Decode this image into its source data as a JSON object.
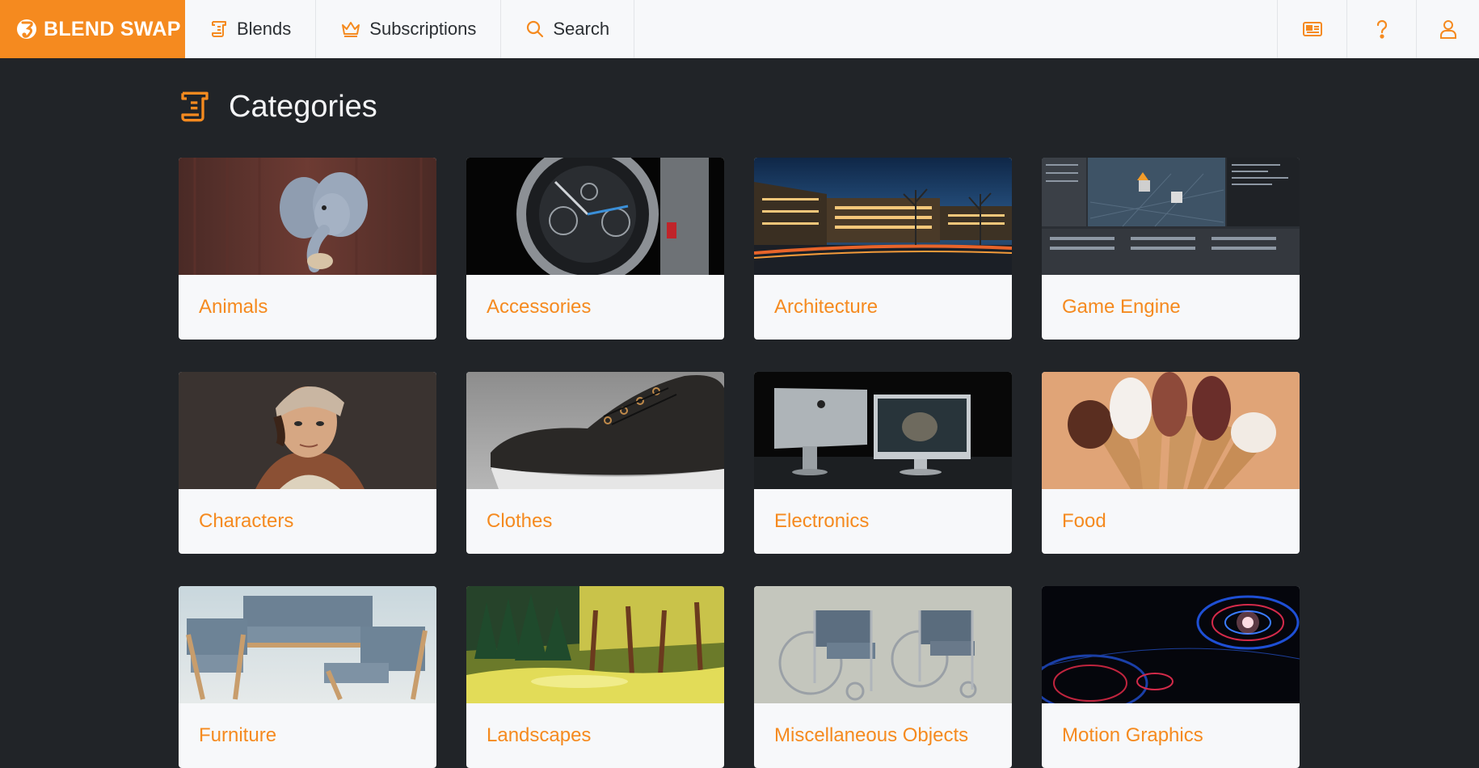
{
  "brand": {
    "name": "BLEND SWAP",
    "color": "#f58a1f"
  },
  "nav": {
    "items": [
      {
        "label": "Blends",
        "icon": "scroll-icon"
      },
      {
        "label": "Subscriptions",
        "icon": "crown-icon"
      },
      {
        "label": "Search",
        "icon": "search-icon"
      }
    ],
    "right_icons": [
      "newspaper-icon",
      "question-icon",
      "user-icon"
    ]
  },
  "page": {
    "title": "Categories",
    "icon": "scroll-icon"
  },
  "categories": [
    {
      "label": "Animals",
      "image": "knitted-elephant"
    },
    {
      "label": "Accessories",
      "image": "wristwatch"
    },
    {
      "label": "Architecture",
      "image": "night-building"
    },
    {
      "label": "Game Engine",
      "image": "blender-editor"
    },
    {
      "label": "Characters",
      "image": "character-portrait"
    },
    {
      "label": "Clothes",
      "image": "sneaker"
    },
    {
      "label": "Electronics",
      "image": "desktop-computers"
    },
    {
      "label": "Food",
      "image": "ice-cream-cones"
    },
    {
      "label": "Furniture",
      "image": "sofa-and-chairs"
    },
    {
      "label": "Landscapes",
      "image": "lowpoly-forest"
    },
    {
      "label": "Miscellaneous Objects",
      "image": "wheelchairs"
    },
    {
      "label": "Motion Graphics",
      "image": "hud-circles"
    }
  ]
}
